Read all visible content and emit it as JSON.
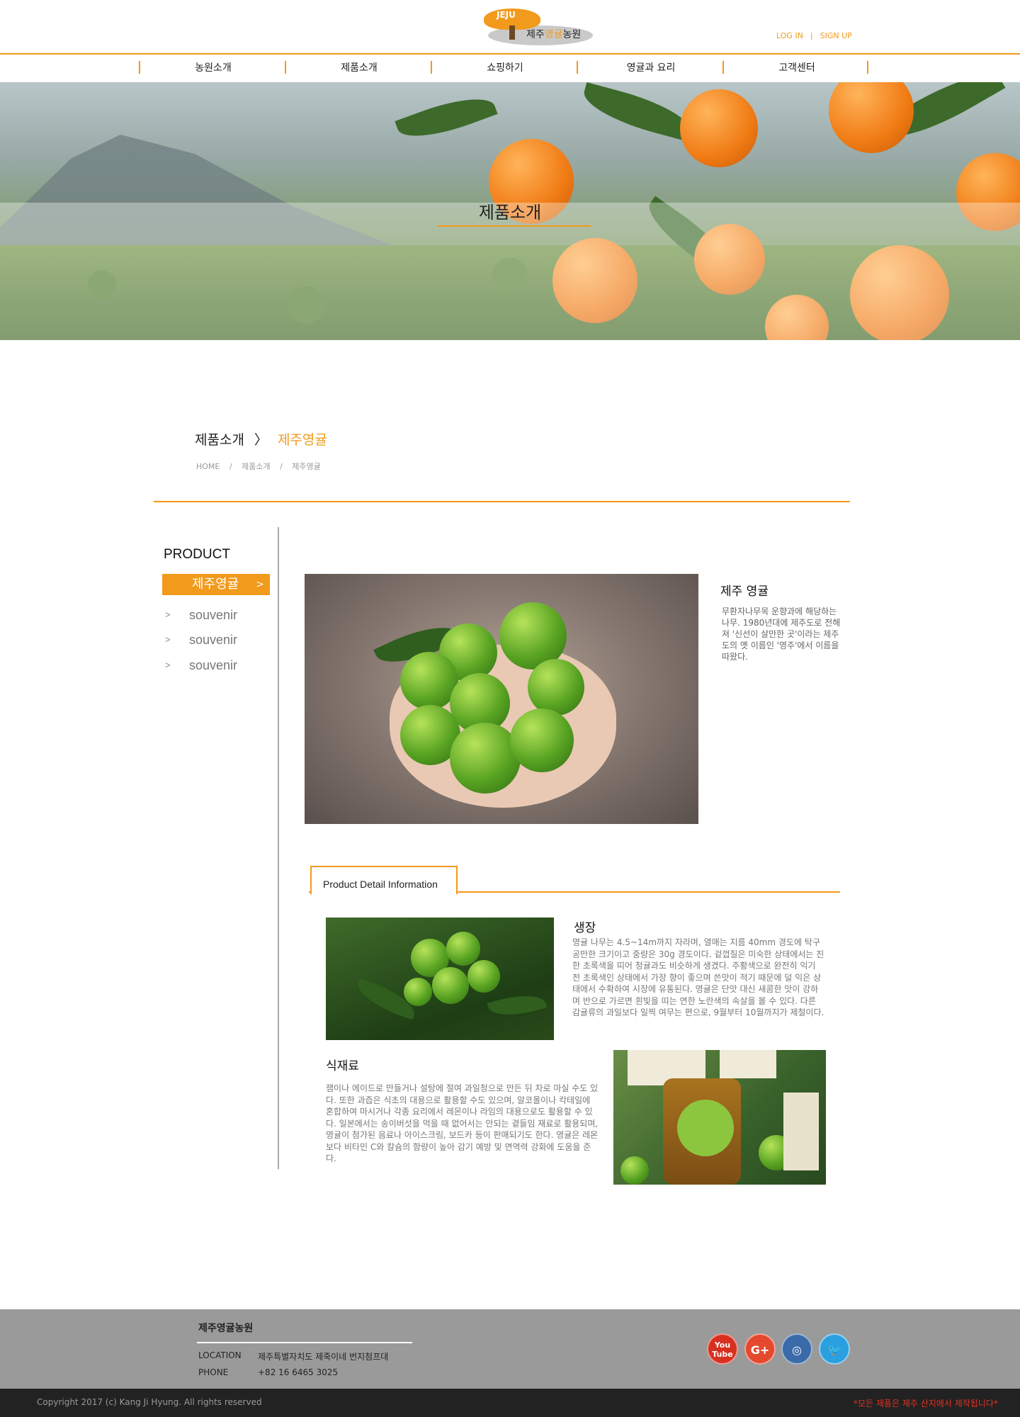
{
  "header": {
    "logo_badge": "JEJU",
    "logo_prefix": "제주",
    "logo_highlight": "영귤",
    "logo_suffix": "농원",
    "login": "LOG IN",
    "auth_separator": "|",
    "signup": "SIGN UP",
    "accent": "#f29a1c"
  },
  "nav": {
    "items": [
      "농원소개",
      "제품소개",
      "쇼핑하기",
      "영귤과 요리",
      "고객센터"
    ]
  },
  "banner": {
    "title": "제품소개"
  },
  "breadcrumb": {
    "section": "제품소개",
    "arrow": "〉",
    "current": "제주영귤",
    "path": [
      "HOME",
      "/",
      "제품소개",
      "/",
      "제주영귤"
    ]
  },
  "sidebar": {
    "title": "PRODUCT",
    "active": "제주영귤",
    "active_chevron": ">",
    "items": [
      "souvenir",
      "souvenir",
      "souvenir"
    ],
    "item_chevron": ">"
  },
  "product": {
    "title": "제주 영귤",
    "description": "무환자나무목 운향과에 해당하는 나무. 1980년대에 제주도로 전해져 '신선이 살만한 곳'이라는 제주도의 옛 이름인 '영주'에서 이름을 따왔다."
  },
  "detail": {
    "tab_label": "Product Detail Information",
    "growth_title": "생장",
    "growth_text": "영귤 나무는 4.5~14m까지 자라며, 열매는 지름 40mm 경도에 탁구공만한 크기이고 중량은 30g 경도이다. 겉껍질은 미숙한 상태에서는 진한 초록색을 띠어 청귤과도 비슷하게 생겼다. 주황색으로 완전히 익기 전 초록색인 상태에서 가장 향이 좋으며 쓴맛이 적기 때문에 덜 익은 상태에서 수확하여 시장에 유통된다. 영귤은 단맛 대신 새콤한 맛이 강하며 반으로 가르면 흰빛을 띠는 연한 노란색의 속살을 볼 수 있다. 다른 감귤류의 과일보다 일찍 여무는 편으로, 9월부터 10월까지가 제철이다.",
    "ingredient_title": "식재료",
    "ingredient_text": "잼이나 에이드로 만들거나 설탕에 절여 과일청으로 만든 뒤 차로 마실 수도 있다. 또한 과즙은 식초의 대용으로 활용할 수도 있으며, 알코올이나 칵테일에 혼합하여 마시거나 각종 요리에서 레몬이나 라임의 대용으로도 활용할 수 있다. 일본에서는 송이버섯을 먹을 때 없어서는 안되는 곁들임 재료로 활용되며, 영귤이 첨가된 음료나 아이스크림, 보드카 등이 판매되기도 한다. 영귤은 레몬보다 비타민 C와 칼슘의 함량이 높아 감기 예방 및 면역력 강화에 도움을 준다."
  },
  "footer": {
    "name": "제주영귤농원",
    "location_label": "LOCATION",
    "location_value": "제주특별자치도 제죽이네 번지첨프대",
    "phone_label": "PHONE",
    "phone_value": "+82 16 6465 3025",
    "social": {
      "youtube_top": "You",
      "youtube_bottom": "Tube",
      "googleplus": "G+",
      "instagram": "◎",
      "twitter": "🐦"
    },
    "copyright": "Copyright 2017 (c) Kang Ji Hyung. All rights reserved",
    "notice": "*모든 제품은 제주 산지에서 제작됩니다*"
  }
}
